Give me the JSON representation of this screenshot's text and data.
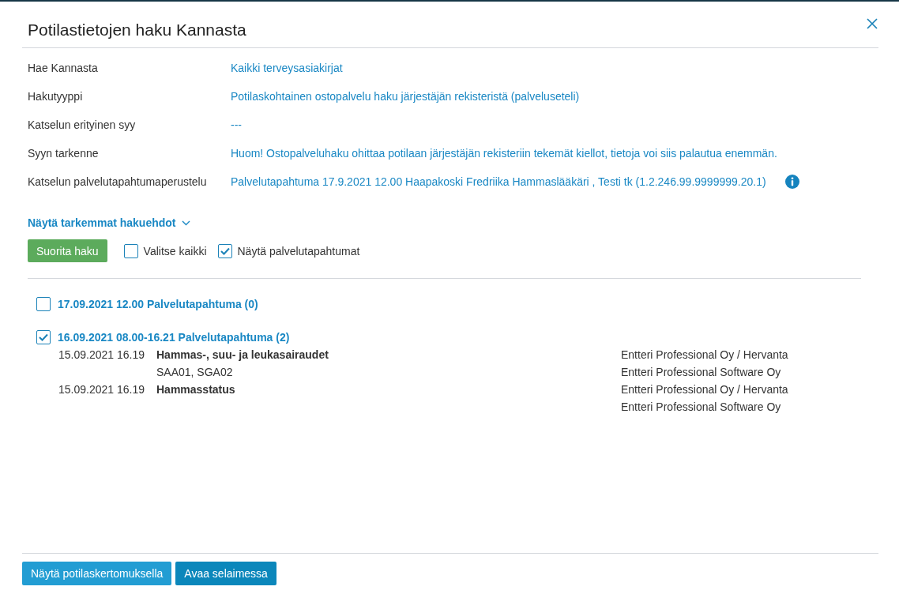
{
  "dialog": {
    "title": "Potilastietojen haku Kannasta"
  },
  "fields": [
    {
      "label": "Hae Kannasta",
      "value": "Kaikki terveysasiakirjat",
      "info": false
    },
    {
      "label": "Hakutyyppi",
      "value": "Potilaskohtainen ostopalvelu haku järjestäjän rekisteristä (palveluseteli)",
      "info": false
    },
    {
      "label": "Katselun erityinen syy",
      "value": "---",
      "info": false
    },
    {
      "label": "Syyn tarkenne",
      "value": "Huom! Ostopalveluhaku ohittaa potilaan järjestäjän rekisteriin tekemät kiellot, tietoja voi siis palautua enemmän.",
      "info": false
    },
    {
      "label": "Katselun palvelutapahtumaperustelu",
      "value": "Palvelutapahtuma 17.9.2021 12.00 Haapakoski Fredriika Hammaslääkäri , Testi tk (1.2.246.99.9999999.20.1)",
      "info": true
    }
  ],
  "advanced_toggle": {
    "label": "Näytä tarkemmat hakuehdot",
    "expanded": false
  },
  "toolbar": {
    "search_button": "Suorita haku",
    "checkboxes": [
      {
        "label": "Valitse kaikki",
        "checked": false
      },
      {
        "label": "Näytä palvelutapahtumat",
        "checked": true
      }
    ]
  },
  "service_events": [
    {
      "title": "17.09.2021 12.00 Palvelutapahtuma (0)",
      "checked": false
    },
    {
      "title": "16.09.2021 08.00-16.21 Palvelutapahtuma (2)",
      "checked": true,
      "entries": [
        {
          "time": "15.09.2021 16.19",
          "title": "Hammas-, suu- ja leukasairaudet",
          "codes": "SAA01, SGA02",
          "organization_lines": [
            "Entteri Professional Oy / Hervanta",
            "Entteri Professional Software Oy"
          ]
        },
        {
          "time": "15.09.2021 16.19",
          "title": "Hammasstatus",
          "organization_lines": [
            "Entteri Professional Oy / Hervanta",
            "Entteri Professional Software Oy"
          ]
        }
      ]
    }
  ],
  "footer_buttons": [
    {
      "label": "Näytä potilaskertomuksella",
      "hovered": true
    },
    {
      "label": "Avaa selaimessa",
      "hovered": false
    }
  ]
}
